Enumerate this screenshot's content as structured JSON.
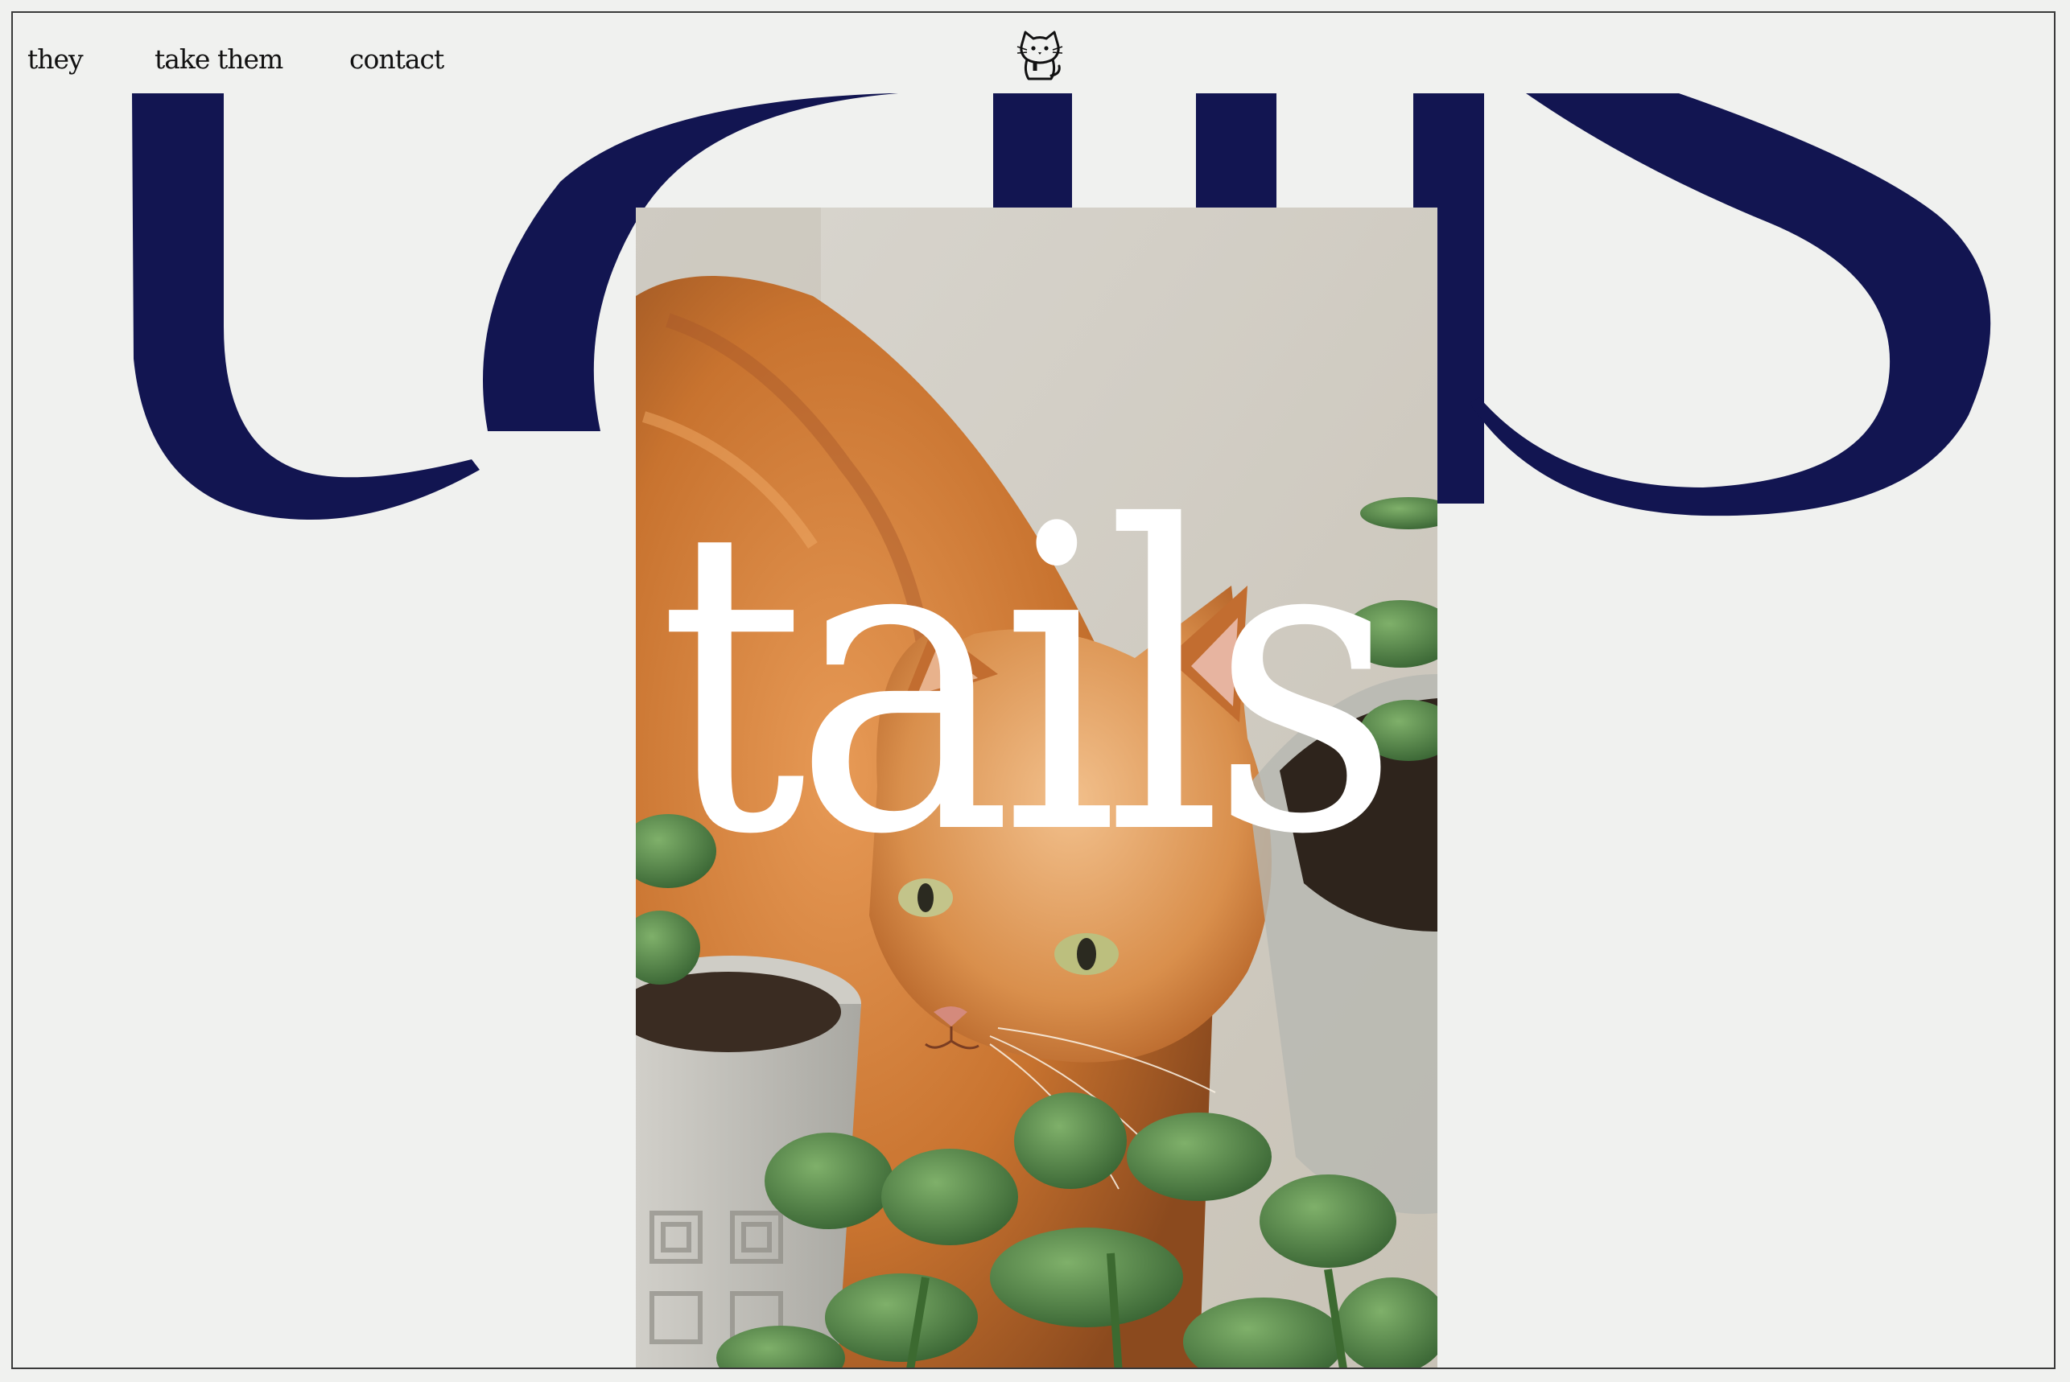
{
  "nav": {
    "items": [
      {
        "label": "they"
      },
      {
        "label": "take them"
      },
      {
        "label": "contact"
      }
    ]
  },
  "logo": {
    "icon": "cat-logo-icon"
  },
  "background_word": {
    "text": "tails",
    "color": "#121551"
  },
  "hero": {
    "title": "tails",
    "title_color": "#ffffff",
    "photo": "ginger-cat-with-potted-plants-photo"
  },
  "colors": {
    "page_background": "#f0f1ef",
    "accent_navy": "#121551",
    "frame_border": "#3a3a3a"
  }
}
